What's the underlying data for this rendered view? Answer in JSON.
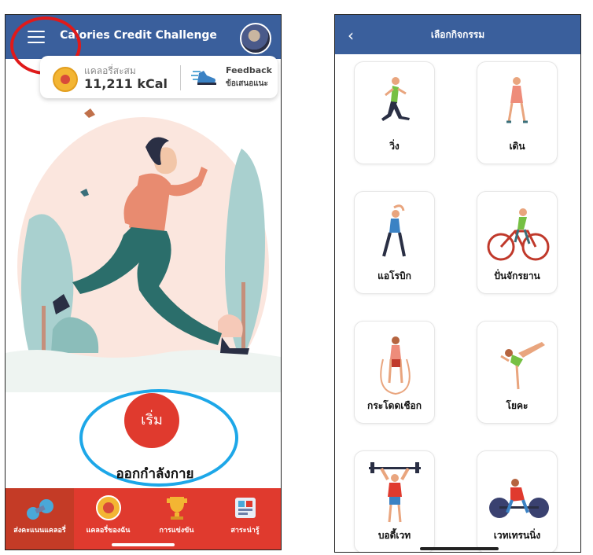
{
  "left_screen": {
    "title": "Calories Credit Challenge",
    "calorie_label": "แคลอรี่สะสม",
    "calorie_value": "11,211 kCal",
    "feedback_title": "Feedback",
    "feedback_sub": "ข้อเสนอแนะ",
    "start_button": "เริ่ม",
    "exercise_label": "ออกกำลังกาย",
    "nav": [
      {
        "label": "ส่งคะแนนแคลอรี่",
        "icon": "dumbbell-icon",
        "active": true
      },
      {
        "label": "แคลอรี่ของฉัน",
        "icon": "coin-icon",
        "active": false
      },
      {
        "label": "การแข่งขัน",
        "icon": "trophy-icon",
        "active": false
      },
      {
        "label": "สาระน่ารู้",
        "icon": "info-icon",
        "active": false
      }
    ]
  },
  "right_screen": {
    "title": "เลือกกิจกรรม",
    "activities": [
      {
        "label": "วิ่ง",
        "icon": "running-icon"
      },
      {
        "label": "เดิน",
        "icon": "walking-icon"
      },
      {
        "label": "แอโรบิก",
        "icon": "aerobic-icon"
      },
      {
        "label": "ปั่นจักรยาน",
        "icon": "cycling-icon"
      },
      {
        "label": "กระโดดเชือก",
        "icon": "jump-rope-icon"
      },
      {
        "label": "โยคะ",
        "icon": "yoga-icon"
      },
      {
        "label": "บอดี้เวท",
        "icon": "bodyweight-icon"
      },
      {
        "label": "เวทเทรนนิ่ง",
        "icon": "weight-training-icon"
      }
    ]
  },
  "colors": {
    "header_blue": "#3a5f9c",
    "accent_red": "#e03a2e",
    "highlight_red": "#e01a1a",
    "highlight_blue": "#1da7e8"
  }
}
